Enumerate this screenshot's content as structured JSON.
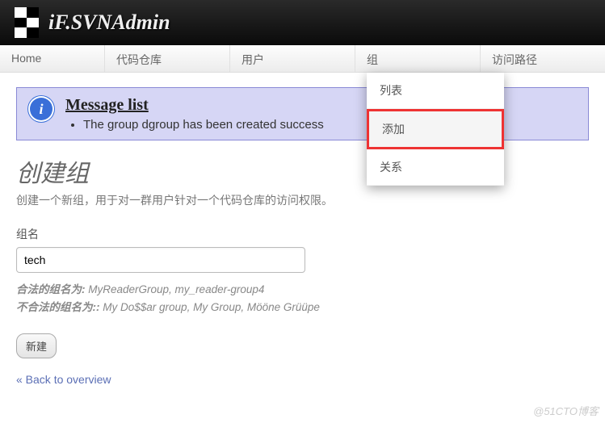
{
  "header": {
    "title": "iF.SVNAdmin"
  },
  "nav": {
    "items": [
      "Home",
      "代码仓库",
      "用户",
      "组",
      "访问路径"
    ]
  },
  "dropdown": {
    "items": [
      "列表",
      "添加",
      "关系"
    ],
    "highlighted_index": 1
  },
  "message": {
    "title": "Message list",
    "text": "The group dgroup has been created success"
  },
  "page": {
    "heading": "创建组",
    "description": "创建一个新组，用于对一群用户针对一个代码仓库的访问权限。",
    "field_label": "组名",
    "field_value": "tech",
    "valid_label": "合法的组名为:",
    "valid_examples": "MyReaderGroup, my_reader-group4",
    "invalid_label": "不合法的组名为::",
    "invalid_examples": "My Do$$ar group, My Group, Mööne Grüüpe",
    "submit_label": "新建",
    "back_label": "« Back to overview"
  },
  "watermark": "@51CTO博客",
  "icons": {
    "info": "i"
  }
}
